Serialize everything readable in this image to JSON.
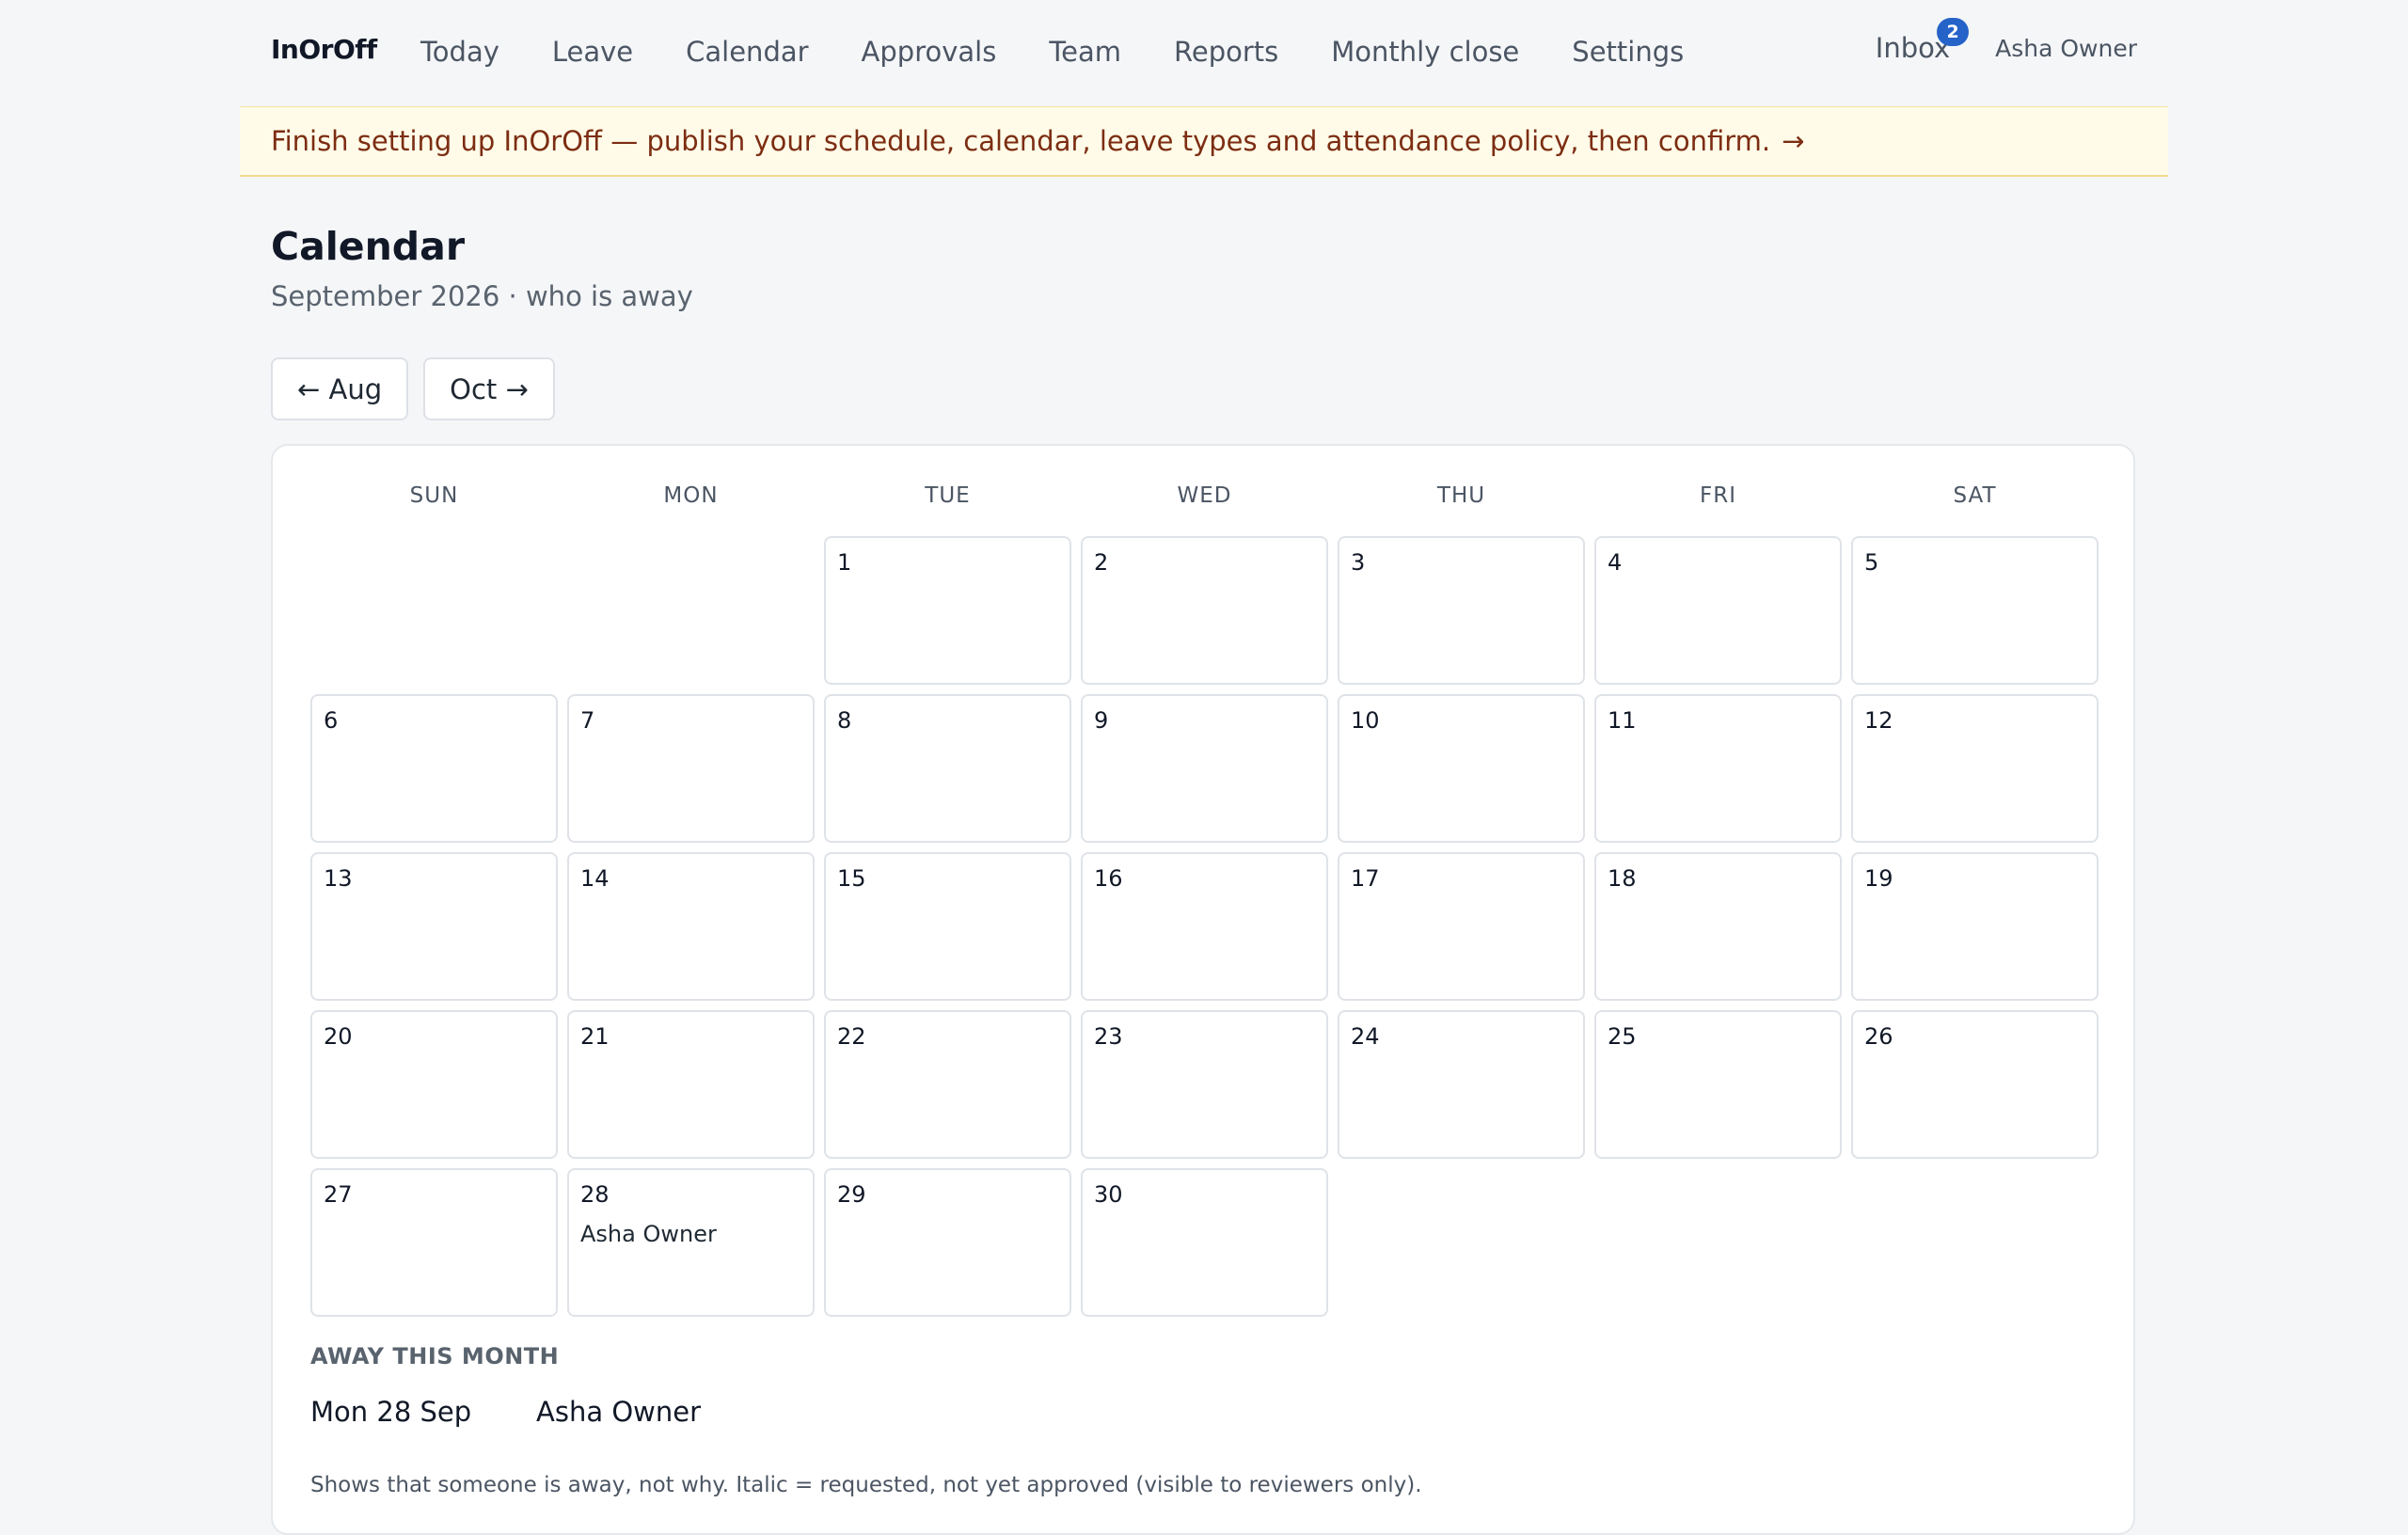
{
  "app": {
    "brand": "InOrOff"
  },
  "nav": {
    "items": [
      {
        "label": "Today"
      },
      {
        "label": "Leave"
      },
      {
        "label": "Calendar"
      },
      {
        "label": "Approvals"
      },
      {
        "label": "Team"
      },
      {
        "label": "Reports"
      },
      {
        "label": "Monthly close"
      },
      {
        "label": "Settings"
      }
    ],
    "inbox_label": "Inbox",
    "inbox_count": "2",
    "user": "Asha Owner"
  },
  "banner": {
    "text": "Finish setting up InOrOff — publish your schedule, calendar, leave types and attendance policy, then confirm.",
    "arrow": "→"
  },
  "page": {
    "title": "Calendar",
    "subtitle": "September 2026 · who is away",
    "prev_label": "← Aug",
    "next_label": "Oct →"
  },
  "calendar": {
    "weekdays": [
      "SUN",
      "MON",
      "TUE",
      "WED",
      "THU",
      "FRI",
      "SAT"
    ],
    "leading_blanks": 2,
    "days": [
      {
        "day": "1",
        "away": ""
      },
      {
        "day": "2",
        "away": ""
      },
      {
        "day": "3",
        "away": ""
      },
      {
        "day": "4",
        "away": ""
      },
      {
        "day": "5",
        "away": ""
      },
      {
        "day": "6",
        "away": ""
      },
      {
        "day": "7",
        "away": ""
      },
      {
        "day": "8",
        "away": ""
      },
      {
        "day": "9",
        "away": ""
      },
      {
        "day": "10",
        "away": ""
      },
      {
        "day": "11",
        "away": ""
      },
      {
        "day": "12",
        "away": ""
      },
      {
        "day": "13",
        "away": ""
      },
      {
        "day": "14",
        "away": ""
      },
      {
        "day": "15",
        "away": ""
      },
      {
        "day": "16",
        "away": ""
      },
      {
        "day": "17",
        "away": ""
      },
      {
        "day": "18",
        "away": ""
      },
      {
        "day": "19",
        "away": ""
      },
      {
        "day": "20",
        "away": ""
      },
      {
        "day": "21",
        "away": ""
      },
      {
        "day": "22",
        "away": ""
      },
      {
        "day": "23",
        "away": ""
      },
      {
        "day": "24",
        "away": ""
      },
      {
        "day": "25",
        "away": ""
      },
      {
        "day": "26",
        "away": ""
      },
      {
        "day": "27",
        "away": ""
      },
      {
        "day": "28",
        "away": "Asha Owner"
      },
      {
        "day": "29",
        "away": ""
      },
      {
        "day": "30",
        "away": ""
      }
    ]
  },
  "away": {
    "heading": "AWAY THIS MONTH",
    "rows": [
      {
        "date": "Mon 28 Sep",
        "name": "Asha Owner"
      }
    ]
  },
  "footnote": "Shows that someone is away, not why. Italic = requested, not yet approved (visible to reviewers only).",
  "colors": {
    "accent": "#2563c9",
    "banner_bg": "#fffbe8",
    "banner_text": "#7c2d12"
  }
}
